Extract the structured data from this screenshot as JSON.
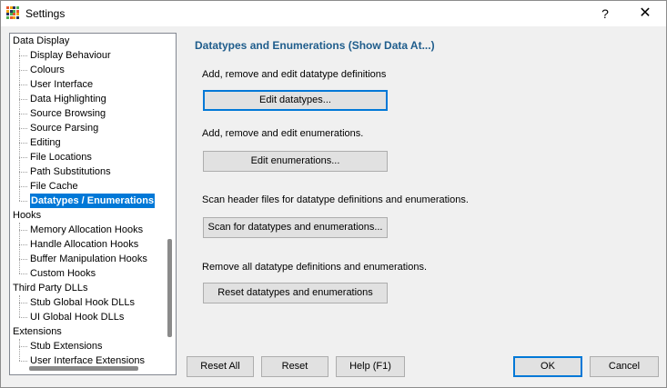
{
  "window": {
    "title": "Settings",
    "help_label": "?",
    "close_label": "✕"
  },
  "colors": {
    "accent": "#0078d7",
    "section_title": "#1f5d8c",
    "app_icon": [
      "#e4572e",
      "#f3a712",
      "#29335c",
      "#4caf50"
    ]
  },
  "tree": {
    "items": [
      {
        "label": "Data Display",
        "level": 0
      },
      {
        "label": "Display Behaviour",
        "level": 1
      },
      {
        "label": "Colours",
        "level": 1
      },
      {
        "label": "User Interface",
        "level": 1
      },
      {
        "label": "Data Highlighting",
        "level": 1
      },
      {
        "label": "Source Browsing",
        "level": 1
      },
      {
        "label": "Source Parsing",
        "level": 1
      },
      {
        "label": "Editing",
        "level": 1
      },
      {
        "label": "File Locations",
        "level": 1
      },
      {
        "label": "Path Substitutions",
        "level": 1
      },
      {
        "label": "File Cache",
        "level": 1
      },
      {
        "label": "Datatypes / Enumerations",
        "level": 1,
        "selected": true
      },
      {
        "label": "Hooks",
        "level": 0
      },
      {
        "label": "Memory Allocation Hooks",
        "level": 1
      },
      {
        "label": "Handle Allocation Hooks",
        "level": 1
      },
      {
        "label": "Buffer Manipulation Hooks",
        "level": 1
      },
      {
        "label": "Custom Hooks",
        "level": 1
      },
      {
        "label": "Third Party DLLs",
        "level": 0
      },
      {
        "label": "Stub Global Hook DLLs",
        "level": 1
      },
      {
        "label": "UI Global Hook DLLs",
        "level": 1
      },
      {
        "label": "Extensions",
        "level": 0
      },
      {
        "label": "Stub Extensions",
        "level": 1
      },
      {
        "label": "User Interface Extensions",
        "level": 1
      }
    ]
  },
  "panel": {
    "title": "Datatypes and Enumerations (Show Data At...)",
    "sections": [
      {
        "description": "Add, remove and edit datatype definitions",
        "button": "Edit datatypes..."
      },
      {
        "description": "Add, remove and edit enumerations.",
        "button": "Edit enumerations..."
      },
      {
        "description": "Scan header files for datatype definitions and enumerations.",
        "button": "Scan for datatypes and enumerations..."
      },
      {
        "description": "Remove all datatype definitions and enumerations.",
        "button": "Reset datatypes and enumerations"
      }
    ]
  },
  "footer": {
    "reset_all": "Reset All",
    "reset": "Reset",
    "help": "Help (F1)",
    "ok": "OK",
    "cancel": "Cancel"
  }
}
